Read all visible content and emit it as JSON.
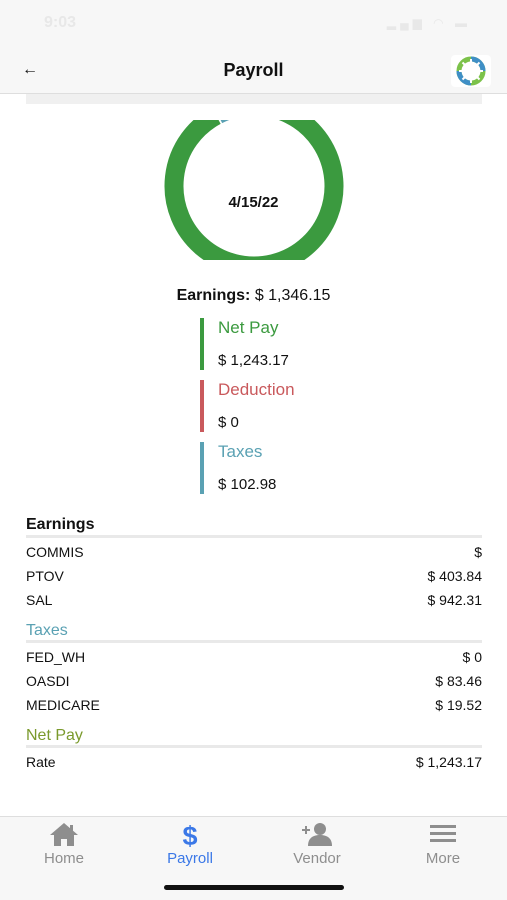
{
  "status": {
    "time": "9:03",
    "icons": "signal wifi battery"
  },
  "nav": {
    "title": "Payroll",
    "back_icon": "arrow-left-icon",
    "logo": "company-logo"
  },
  "summary": {
    "date": "4/15/22",
    "earnings_label": "Earnings:",
    "earnings_value": "$ 1,346.15",
    "chart_data": {
      "type": "pie",
      "slices": [
        {
          "label": "Net Pay",
          "value": 1243.17,
          "color": "#3b9a3f"
        },
        {
          "label": "Deduction",
          "value": 0,
          "color": "#c9595c"
        },
        {
          "label": "Taxes",
          "value": 102.98,
          "color": "#5aa1b3"
        }
      ]
    },
    "legend": [
      {
        "title": "Net Pay",
        "value": "$ 1,243.17",
        "color": "#3b9a3f"
      },
      {
        "title": "Deduction",
        "value": "$ 0",
        "color": "#c9595c"
      },
      {
        "title": "Taxes",
        "value": "$ 102.98",
        "color": "#5aa1b3"
      }
    ]
  },
  "sections": {
    "earnings": {
      "title": "Earnings",
      "color": "#111111",
      "rows": [
        {
          "name": "COMMIS",
          "value": "$"
        },
        {
          "name": "PTOV",
          "value": "$ 403.84"
        },
        {
          "name": "SAL",
          "value": "$ 942.31"
        }
      ]
    },
    "taxes": {
      "title": "Taxes",
      "color": "#5aa1b3",
      "rows": [
        {
          "name": "FED_WH",
          "value": "$ 0"
        },
        {
          "name": "OASDI",
          "value": "$ 83.46"
        },
        {
          "name": "MEDICARE",
          "value": "$ 19.52"
        }
      ]
    },
    "net_pay": {
      "title": "Net Pay",
      "color": "#7a9a2c",
      "rows": [
        {
          "name": "Rate",
          "value": "$ 1,243.17"
        }
      ]
    }
  },
  "tabs": [
    {
      "label": "Home",
      "icon": "home-icon",
      "active": false
    },
    {
      "label": "Payroll",
      "icon": "dollar-icon",
      "active": true
    },
    {
      "label": "Vendor",
      "icon": "add-user-icon",
      "active": false
    },
    {
      "label": "More",
      "icon": "menu-icon",
      "active": false
    }
  ],
  "colors": {
    "active_tab": "#3b78e7",
    "inactive_tab": "#8e8e8e"
  }
}
